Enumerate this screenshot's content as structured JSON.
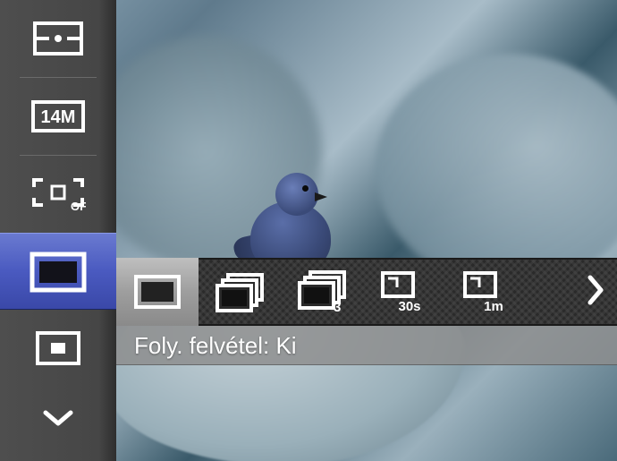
{
  "sidebar": {
    "items": [
      {
        "name": "metering-mode",
        "icon": "metering-multi-icon"
      },
      {
        "name": "resolution-14m",
        "icon": "resolution-14m-icon",
        "label": "14M"
      },
      {
        "name": "focus-area-off",
        "icon": "focus-area-off-icon",
        "label": "OFF"
      },
      {
        "name": "drive-mode",
        "icon": "single-frame-icon",
        "selected": true
      },
      {
        "name": "picture-in-picture",
        "icon": "pip-icon"
      },
      {
        "name": "more-down",
        "icon": "chevron-down-icon"
      }
    ]
  },
  "drive_options": {
    "items": [
      {
        "name": "single",
        "icon": "single-frame-icon",
        "selected": true
      },
      {
        "name": "burst",
        "icon": "burst-icon"
      },
      {
        "name": "burst-3",
        "icon": "burst-3-icon",
        "label": "3"
      },
      {
        "name": "interval-30s",
        "icon": "interval-icon",
        "label": "30s"
      },
      {
        "name": "interval-1m",
        "icon": "interval-icon",
        "label": "1m"
      }
    ],
    "more": true
  },
  "caption": "Foly. felvétel: Ki",
  "colors": {
    "selection": "#4a5ac0",
    "sidebar": "#464646",
    "strip": "#2a2a2a",
    "caption_bg": "rgba(140,140,140,0.82)"
  }
}
